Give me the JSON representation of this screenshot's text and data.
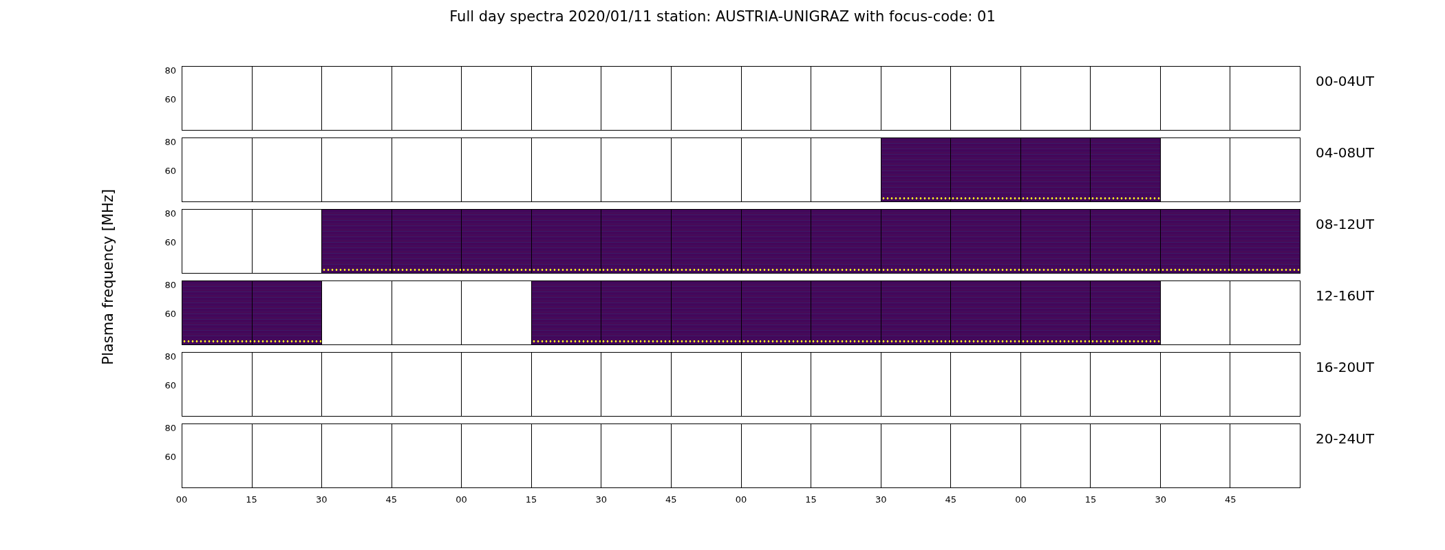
{
  "title": "Full day spectra 2020/01/11 station: AUSTRIA-UNIGRAZ with focus-code: 01",
  "ylabel": "Plasma frequency [MHz]",
  "rows": [
    {
      "label": "00-04UT",
      "yticks": [
        "80",
        "60"
      ],
      "panels": [
        {
          "has_data": false
        },
        {
          "has_data": false
        },
        {
          "has_data": false
        },
        {
          "has_data": false
        },
        {
          "has_data": false
        },
        {
          "has_data": false
        },
        {
          "has_data": false
        },
        {
          "has_data": false
        },
        {
          "has_data": false
        },
        {
          "has_data": false
        },
        {
          "has_data": false
        },
        {
          "has_data": false
        },
        {
          "has_data": false
        },
        {
          "has_data": false
        },
        {
          "has_data": false
        },
        {
          "has_data": false
        }
      ]
    },
    {
      "label": "04-08UT",
      "yticks": [
        "80",
        "60"
      ],
      "panels": [
        {
          "has_data": false
        },
        {
          "has_data": false
        },
        {
          "has_data": false
        },
        {
          "has_data": false
        },
        {
          "has_data": false
        },
        {
          "has_data": false
        },
        {
          "has_data": false
        },
        {
          "has_data": false
        },
        {
          "has_data": false
        },
        {
          "has_data": false
        },
        {
          "has_data": true
        },
        {
          "has_data": true
        },
        {
          "has_data": true
        },
        {
          "has_data": true
        },
        {
          "has_data": false
        },
        {
          "has_data": false
        }
      ]
    },
    {
      "label": "08-12UT",
      "yticks": [
        "80",
        "60"
      ],
      "panels": [
        {
          "has_data": false
        },
        {
          "has_data": false
        },
        {
          "has_data": true
        },
        {
          "has_data": true
        },
        {
          "has_data": true
        },
        {
          "has_data": true
        },
        {
          "has_data": true
        },
        {
          "has_data": true
        },
        {
          "has_data": true
        },
        {
          "has_data": true
        },
        {
          "has_data": true
        },
        {
          "has_data": true
        },
        {
          "has_data": true
        },
        {
          "has_data": true
        },
        {
          "has_data": true
        },
        {
          "has_data": true
        }
      ]
    },
    {
      "label": "12-16UT",
      "yticks": [
        "80",
        "60"
      ],
      "panels": [
        {
          "has_data": true
        },
        {
          "has_data": true
        },
        {
          "has_data": false
        },
        {
          "has_data": false
        },
        {
          "has_data": false
        },
        {
          "has_data": true
        },
        {
          "has_data": true
        },
        {
          "has_data": true
        },
        {
          "has_data": true
        },
        {
          "has_data": true
        },
        {
          "has_data": true
        },
        {
          "has_data": true
        },
        {
          "has_data": true
        },
        {
          "has_data": true
        },
        {
          "has_data": false
        },
        {
          "has_data": false
        }
      ]
    },
    {
      "label": "16-20UT",
      "yticks": [
        "80",
        "60"
      ],
      "panels": [
        {
          "has_data": false
        },
        {
          "has_data": false
        },
        {
          "has_data": false
        },
        {
          "has_data": false
        },
        {
          "has_data": false
        },
        {
          "has_data": false
        },
        {
          "has_data": false
        },
        {
          "has_data": false
        },
        {
          "has_data": false
        },
        {
          "has_data": false
        },
        {
          "has_data": false
        },
        {
          "has_data": false
        },
        {
          "has_data": false
        },
        {
          "has_data": false
        },
        {
          "has_data": false
        },
        {
          "has_data": false
        }
      ]
    },
    {
      "label": "20-24UT",
      "yticks": [
        "80",
        "60"
      ],
      "panels": [
        {
          "has_data": false
        },
        {
          "has_data": false
        },
        {
          "has_data": false
        },
        {
          "has_data": false
        },
        {
          "has_data": false
        },
        {
          "has_data": false
        },
        {
          "has_data": false
        },
        {
          "has_data": false
        },
        {
          "has_data": false
        },
        {
          "has_data": false
        },
        {
          "has_data": false
        },
        {
          "has_data": false
        },
        {
          "has_data": false
        },
        {
          "has_data": false
        },
        {
          "has_data": false
        },
        {
          "has_data": false
        }
      ]
    }
  ],
  "xticks": [
    "00",
    "15",
    "30",
    "45",
    "00",
    "15",
    "30",
    "45",
    "00",
    "15",
    "30",
    "45",
    "00",
    "15",
    "30",
    "45"
  ]
}
